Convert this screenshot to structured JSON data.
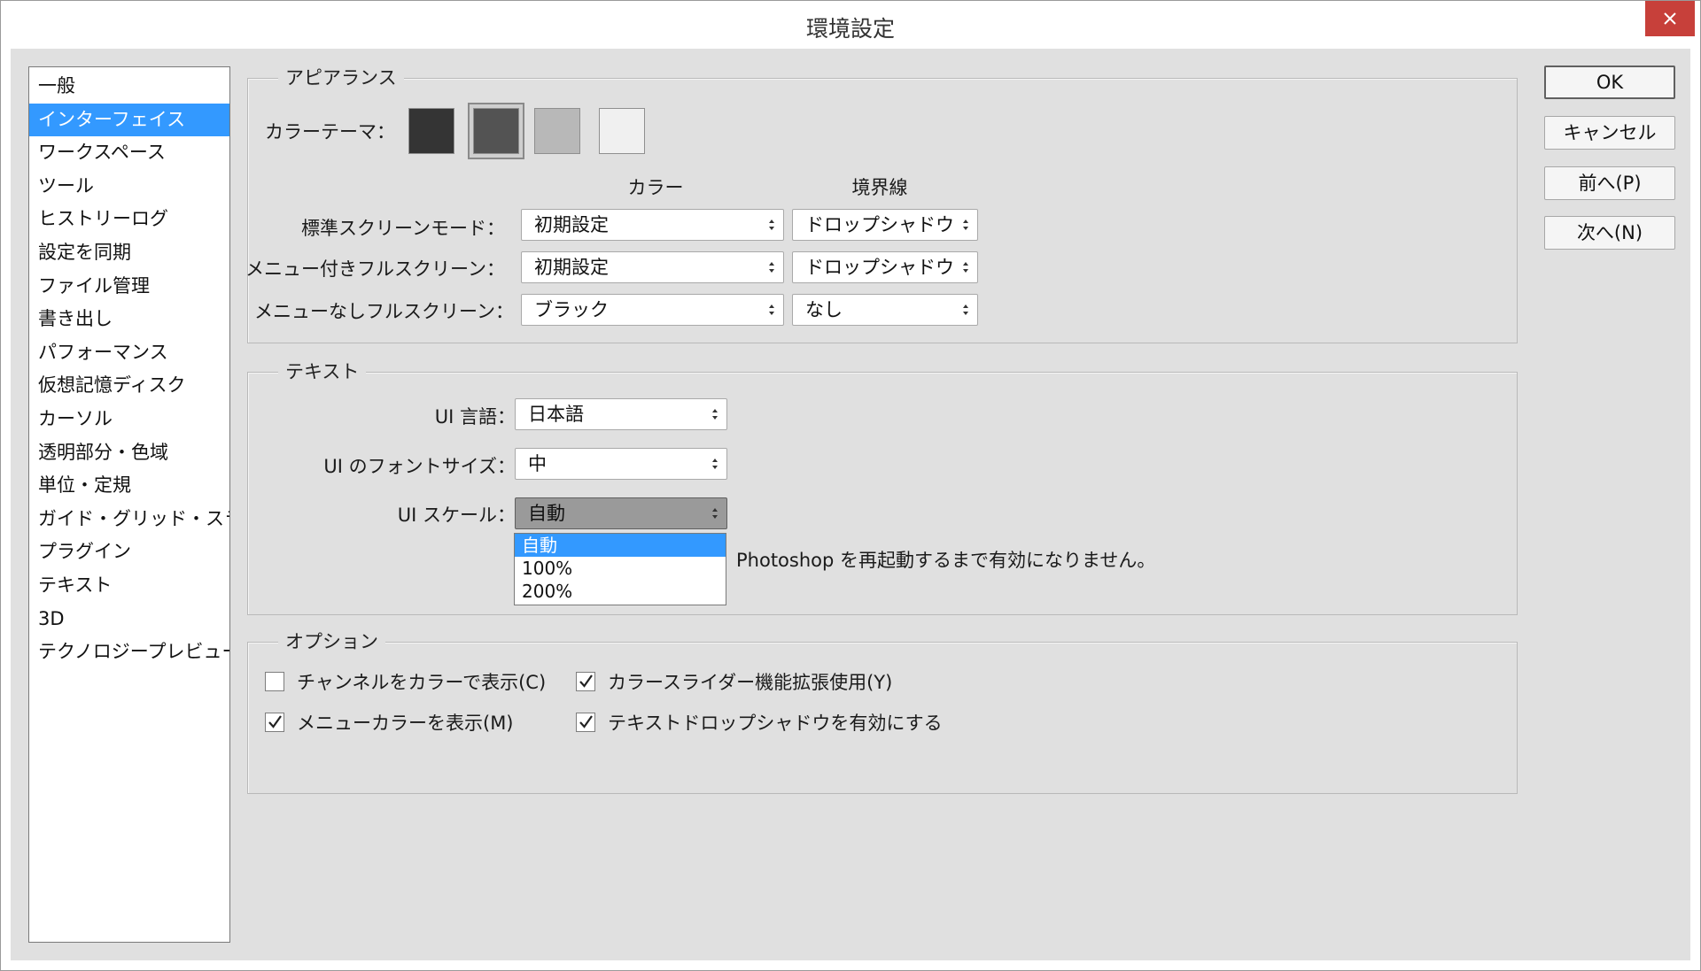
{
  "window": {
    "title": "環境設定"
  },
  "sidebar": {
    "items": [
      "一般",
      "インターフェイス",
      "ワークスペース",
      "ツール",
      "ヒストリーログ",
      "設定を同期",
      "ファイル管理",
      "書き出し",
      "パフォーマンス",
      "仮想記憶ディスク",
      "カーソル",
      "透明部分・色域",
      "単位・定規",
      "ガイド・グリッド・スライス",
      "プラグイン",
      "テキスト",
      "3D",
      "テクノロジープレビュー"
    ],
    "selected_index": 1
  },
  "appearance": {
    "group_title": "アピアランス",
    "color_theme_label": "カラーテーマ：",
    "themes": [
      "#343434",
      "#535353",
      "#b8b8b8",
      "#f0f0f0"
    ],
    "selected_theme": 1,
    "col_color": "カラー",
    "col_border": "境界線",
    "rows": [
      {
        "label": "標準スクリーンモード：",
        "color": "初期設定",
        "border": "ドロップシャドウ"
      },
      {
        "label": "メニュー付きフルスクリーン：",
        "color": "初期設定",
        "border": "ドロップシャドウ"
      },
      {
        "label": "メニューなしフルスクリーン：",
        "color": "ブラック",
        "border": "なし"
      }
    ]
  },
  "text": {
    "group_title": "テキスト",
    "ui_language_label": "UI 言語：",
    "ui_language_value": "日本語",
    "font_size_label": "UI のフォントサイズ：",
    "font_size_value": "中",
    "ui_scale_label": "UI スケール：",
    "ui_scale_value": "自動",
    "ui_scale_options": [
      "自動",
      "100%",
      "200%"
    ],
    "note": "Photoshop を再起動するまで有効になりません。"
  },
  "options": {
    "group_title": "オプション",
    "checkboxes": [
      {
        "label": "チャンネルをカラーで表示(C)",
        "checked": false
      },
      {
        "label": "カラースライダー機能拡張使用(Y)",
        "checked": true
      },
      {
        "label": "メニューカラーを表示(M)",
        "checked": true
      },
      {
        "label": "テキストドロップシャドウを有効にする",
        "checked": true
      }
    ]
  },
  "buttons": {
    "ok": "OK",
    "cancel": "キャンセル",
    "prev": "前へ(P)",
    "next": "次へ(N)"
  }
}
